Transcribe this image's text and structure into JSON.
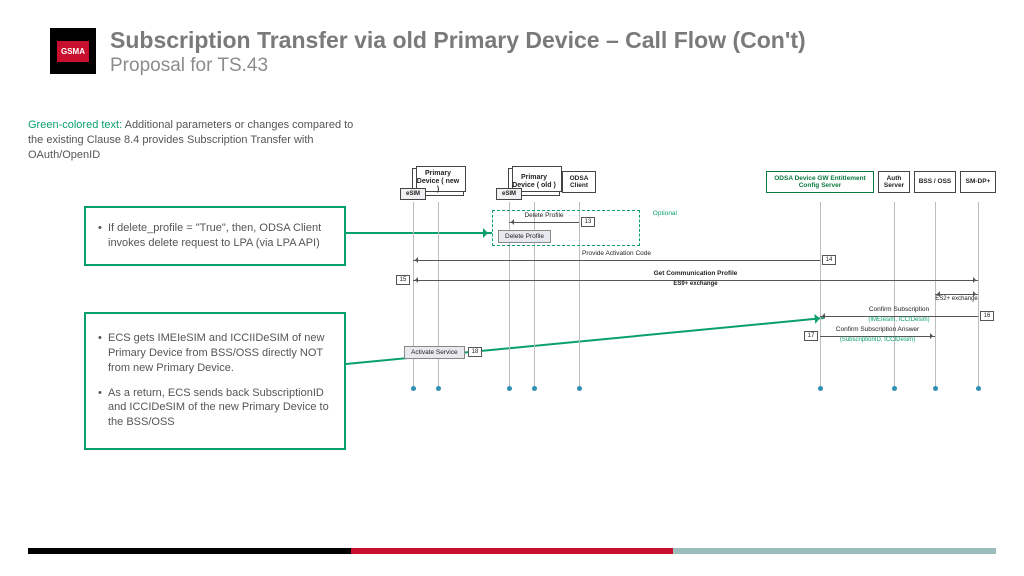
{
  "header": {
    "logo": "GSMA",
    "title": "Subscription Transfer via old Primary Device – Call Flow (Con't)",
    "subtitle": "Proposal for TS.43"
  },
  "legend": {
    "prefix": "Green-colored text:",
    "text": " Additional parameters or changes compared to the existing Clause 8.4 provides Subscription Transfer with OAuth/OpenID"
  },
  "callouts": {
    "c1": {
      "items": [
        "If delete_profile = \"True\", then, ODSA Client  invokes delete request to LPA (via LPA API)"
      ]
    },
    "c2": {
      "items": [
        "ECS gets IMEIeSIM and ICCIIDeSIM of new Primary Device from BSS/OSS directly NOT from new Primary Device.",
        "As a return, ECS sends back SubscriptionID and ICCIDeSIM of the new Primary Device to the BSS/OSS"
      ]
    }
  },
  "participants": {
    "newDevice": "Primary Device ( new )",
    "oldDevice": "Primary Device ( old )",
    "odsaClient": "ODSA Client",
    "esim": "eSIM",
    "gw": "ODSA Device GW Entitlement Config Server",
    "auth": "Auth Server",
    "bss": "BSS / OSS",
    "smdp": "SM-DP+"
  },
  "optional_label": "Optional",
  "actions": {
    "deleteProfile": "Delete Profile",
    "activateService": "Activate Service"
  },
  "messages": {
    "m13": {
      "num": "13",
      "label": "Delete Profile"
    },
    "m14": {
      "num": "14",
      "label": "Provide Activation Code"
    },
    "m15": {
      "num": "15",
      "label": "Get Communication Profile",
      "sub": "ES9+ exchange"
    },
    "m16": {
      "num": "16",
      "label": "Confirm Subscription",
      "sub": "(IMEIesim, ICCIDesim)",
      "side": "ES2+ exchange"
    },
    "m17": {
      "num": "17",
      "label": "Confirm Subscription Answer",
      "sub": "(SubscriptionID, ICCIDesim)"
    },
    "m18": {
      "num": "18",
      "label": ""
    }
  }
}
